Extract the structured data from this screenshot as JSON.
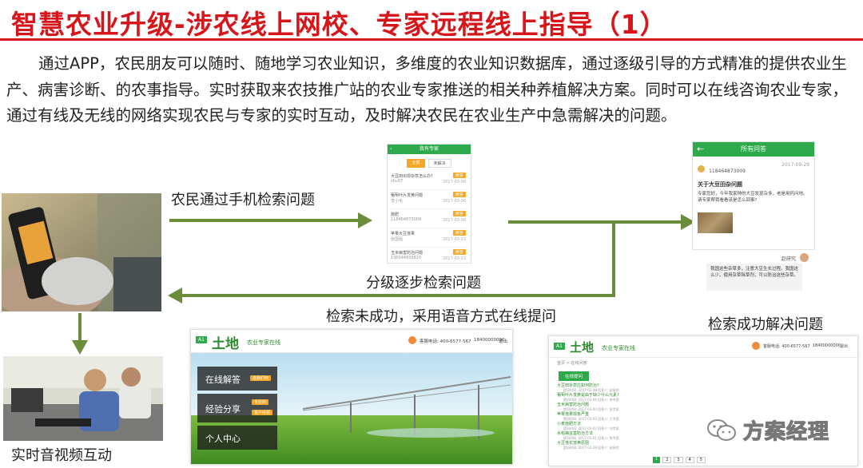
{
  "title": "智慧农业升级-涉农线上网校、专家远程线上指导（1）",
  "paragraph": "通过APP，农民朋友可以随时、随地学习农业知识，多维度的农业知识数据库，通过逐级引导的方式精准的提供农业生产、病害诊断、的农事指导。实时获取来农技推广站的农业专家推送的相关种养植解决方案。同时可以在线咨询农业专家，通过有线及无线的网络实现农民与专家的实时互动，及时解决农民在农业生产中急需解决的问题。",
  "labels": {
    "search_phone": "农民通过手机检索问题",
    "step_search": "分级逐步检索问题",
    "search_fail": "检索未成功，采用语音方式在线提问",
    "search_success": "检索成功解决问题",
    "realtime": "实时音视频互动"
  },
  "phone1": {
    "header": "我有专家",
    "tabs": [
      "全部",
      "未解决"
    ],
    "items": [
      {
        "q": "大豆田出现杂草怎么办?",
        "user": "shu07",
        "date": "2017-03-08",
        "tag": "解答"
      },
      {
        "q": "葡萄叶片发黄问题",
        "user": "李小毛",
        "date": "2017-03-06",
        "tag": "解答"
      },
      {
        "q": "施肥",
        "user": "118464873009",
        "date": "2017-03-08",
        "tag": "解答"
      },
      {
        "q": "苹果大豆落果",
        "user": "张国强",
        "date": "2017-03-03",
        "tag": "解答"
      },
      {
        "q": "玉米病害防治问题",
        "user": "136044838820",
        "date": "2017-03-03",
        "tag": "解答"
      }
    ]
  },
  "phone2": {
    "header": "所有问答",
    "user": "118464873009",
    "date": "2017-09-29",
    "q_title": "关于大豆田杂问题",
    "q_body": "专家您好，今年我家种的大豆发现杂多，老是用药问地。请专家帮我看看该是怎么回事?",
    "answer_user": "赵研究",
    "answer": "我国这些杂草多，注意大豆生长过程。我国这么少。使用杂草除草剂，可以防治这些杂草。"
  },
  "web1": {
    "logo_badge": "A1",
    "logo": "土地",
    "subtitle": "农业专家在线",
    "phone": "客服电话: 400-6577-567",
    "account": "18400000000",
    "logout": "退出",
    "menu": [
      {
        "label": "在线解答",
        "tags": [
          "选我们吧"
        ]
      },
      {
        "label": "经验分享",
        "tags": [
          "专业的",
          "客户经验"
        ]
      },
      {
        "label": "个人中心",
        "tags": []
      }
    ]
  },
  "web2": {
    "logo_badge": "A1",
    "logo": "土地",
    "subtitle": "农业专家在线",
    "phone": "客服电话: 400-6577-567",
    "account": "18400000000",
    "logout": "退出",
    "breadcrumb": "首页 > 在线问答",
    "button": "在线提问",
    "rows": [
      {
        "q": "大豆田杂草应如何防治?",
        "meta": "提问时间: 2017-03-08  回答人: 赵研究"
      },
      {
        "q": "葡萄叶片发黄是由于缺少什么元素?",
        "meta": "提问时间: 2017-03-06  回答人: 李专家"
      },
      {
        "q": "玉米病害防治问题",
        "meta": "提问时间: 2017-03-04  回答人: 张专家"
      },
      {
        "q": "苹果落果现象严重",
        "meta": "提问时间: 2017-03-03  回答人: 王专家"
      },
      {
        "q": "小麦施肥方法",
        "meta": "提问时间: 2017-03-02  回答人: 刘专家"
      },
      {
        "q": "水稻病虫害防治方法",
        "meta": "提问时间: 2017-03-01  回答人: 陈专家"
      },
      {
        "q": "大豆落花落荚原因",
        "meta": "提问时间: 2017-02-28  回答人: 赵研究"
      }
    ],
    "pager": [
      "1",
      "2",
      "3",
      "4",
      "5"
    ]
  },
  "watermark": "方案经理",
  "colors": {
    "title_red": "#d7161c",
    "app_green": "#2eaa4c",
    "arrow": "#6b8c3a",
    "tag_orange": "#f5a623"
  }
}
